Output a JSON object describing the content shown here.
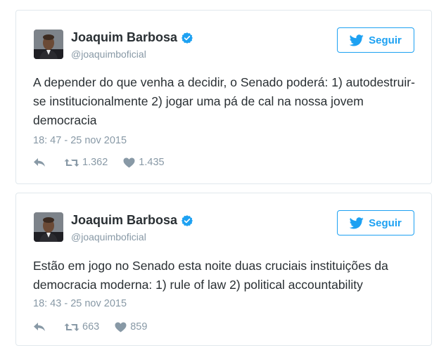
{
  "tweets": [
    {
      "author_name": "Joaquim Barbosa",
      "handle": "@joaquimboficial",
      "follow_label": "Seguir",
      "text": "A depender do que venha a decidir, o Senado poderá: 1) autodestruir-se institucionalmente 2) jogar uma pá de cal na nossa jovem democracia",
      "timestamp": "18: 47 - 25 nov 2015",
      "retweets": "1.362",
      "likes": "1.435"
    },
    {
      "author_name": "Joaquim Barbosa",
      "handle": "@joaquimboficial",
      "follow_label": "Seguir",
      "text": "Estão em jogo no Senado esta noite duas cruciais instituições da democracia moderna: 1) rule of law 2) political accountability",
      "timestamp": "18: 43 - 25 nov 2015",
      "retweets": "663",
      "likes": "859"
    }
  ],
  "icons": {
    "verified": "verified-badge-icon",
    "bird": "twitter-bird-icon",
    "reply": "reply-icon",
    "retweet": "retweet-icon",
    "like": "heart-icon"
  },
  "colors": {
    "accent": "#1da1f2",
    "muted": "#8899a6",
    "text": "#292f33",
    "border": "#e1e8ed"
  }
}
